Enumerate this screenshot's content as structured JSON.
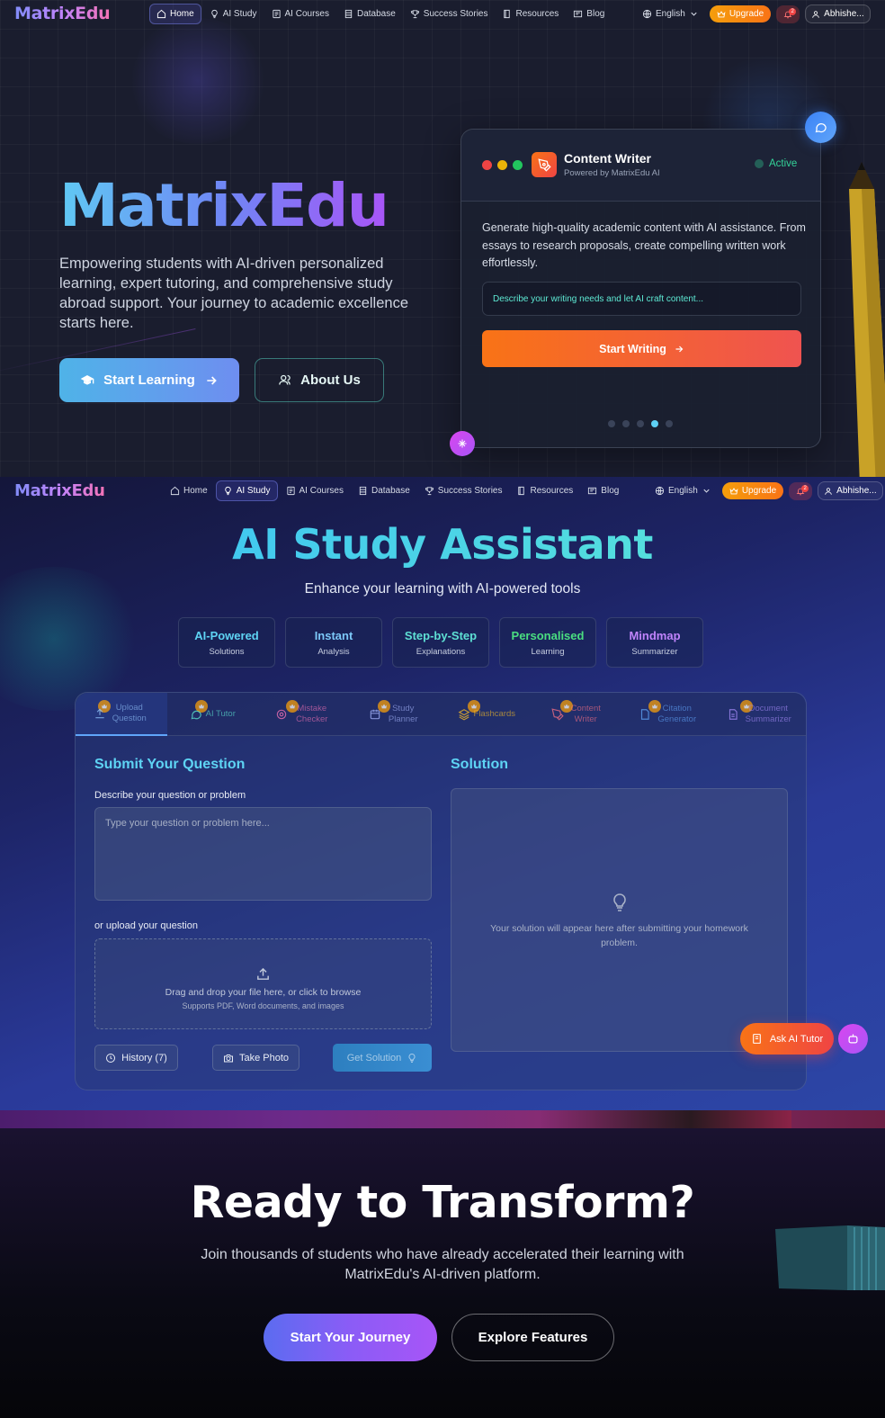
{
  "brand": "MatrixEdu",
  "nav": {
    "links": [
      {
        "label": "Home",
        "icon": "home-icon"
      },
      {
        "label": "AI Study",
        "icon": "bulb-icon"
      },
      {
        "label": "AI Courses",
        "icon": "course-icon"
      },
      {
        "label": "Database",
        "icon": "database-icon"
      },
      {
        "label": "Success Stories",
        "icon": "trophy-icon"
      },
      {
        "label": "Resources",
        "icon": "book-icon"
      },
      {
        "label": "Blog",
        "icon": "blog-icon"
      }
    ],
    "language": "English",
    "upgrade": "Upgrade",
    "notifications": "2",
    "user": "Abhishe..."
  },
  "hero": {
    "title": "MatrixEdu",
    "description": "Empowering students with AI-driven personalized learning, expert tutoring, and comprehensive study abroad support. Your journey to academic excellence starts here.",
    "start_button": "Start Learning",
    "about_button": "About Us",
    "card": {
      "title": "Content Writer",
      "subtitle": "Powered by MatrixEdu AI",
      "status": "Active",
      "body": "Generate high-quality academic content with AI assistance. From essays to research proposals, create compelling written work effortlessly.",
      "input_placeholder": "Describe your writing needs and let AI craft content...",
      "button": "Start Writing",
      "slides": 5,
      "active_slide": 4
    }
  },
  "study": {
    "title": "AI Study Assistant",
    "subtitle": "Enhance your learning with AI-powered tools",
    "features": [
      {
        "title": "AI-Powered",
        "sub": "Solutions",
        "color": "#5ed4f4"
      },
      {
        "title": "Instant",
        "sub": "Analysis",
        "color": "#7cc8f8"
      },
      {
        "title": "Step-by-Step",
        "sub": "Explanations",
        "color": "#5ee0d4"
      },
      {
        "title": "Personalised",
        "sub": "Learning",
        "color": "#4ade80"
      },
      {
        "title": "Mindmap",
        "sub": "Summarizer",
        "color": "#c084fc"
      }
    ],
    "tabs": [
      {
        "label": "Upload Question",
        "color": "#93c5fd",
        "active": true
      },
      {
        "label": "AI Tutor",
        "color": "#5eead4"
      },
      {
        "label": "Mistake Checker",
        "color": "#f472b6"
      },
      {
        "label": "Study Planner",
        "color": "#a5b4fc"
      },
      {
        "label": "Flashcards",
        "color": "#fbbf24"
      },
      {
        "label": "Content Writer",
        "color": "#fb7185"
      },
      {
        "label": "Citation Generator",
        "color": "#60a5fa"
      },
      {
        "label": "Document Summarizer",
        "color": "#a78bfa"
      }
    ],
    "submit_heading": "Submit Your Question",
    "solution_heading": "Solution",
    "question_label": "Describe your question or problem",
    "question_placeholder": "Type your question or problem here...",
    "upload_label": "or upload your question",
    "drop_text": "Drag and drop your file here, or click to browse",
    "drop_hint": "Supports PDF, Word documents, and images",
    "history_button": "History (7)",
    "photo_button": "Take Photo",
    "solution_button": "Get Solution",
    "solution_placeholder": "Your solution will appear here after submitting your homework problem.",
    "ask_tutor": "Ask AI Tutor"
  },
  "cta": {
    "title": "Ready to Transform?",
    "text": "Join thousands of students who have already accelerated their learning with MatrixEdu's AI-driven platform.",
    "primary": "Start Your Journey",
    "secondary": "Explore Features"
  }
}
